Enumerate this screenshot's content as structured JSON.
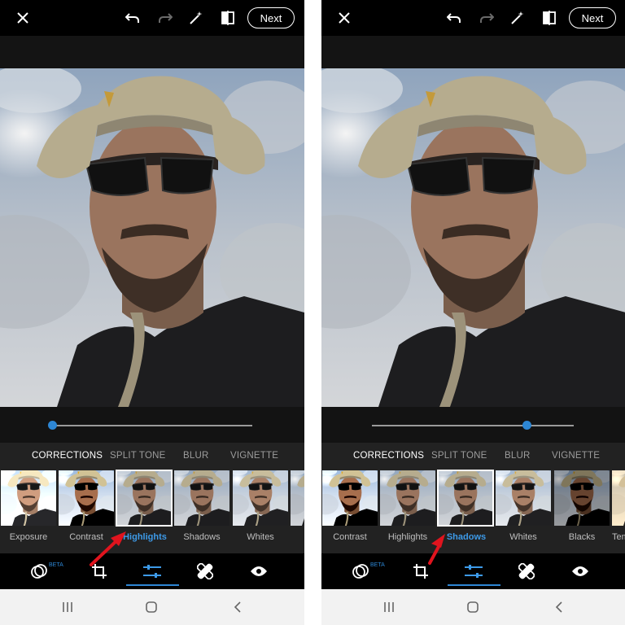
{
  "toolbar": {
    "next_label": "Next"
  },
  "tabs": [
    "CORRECTIONS",
    "SPLIT TONE",
    "BLUR",
    "VIGNETTE"
  ],
  "bottom_tools": {
    "beta_label": "BETA"
  },
  "left_panel": {
    "slider_value_fraction": 0.0,
    "thumbnail_labels": [
      "Exposure",
      "Contrast",
      "Highlights",
      "Shadows",
      "Whites"
    ],
    "selected": "Highlights"
  },
  "right_panel": {
    "slider_value_fraction": 0.77,
    "thumbnail_labels": [
      "Contrast",
      "Highlights",
      "Shadows",
      "Whites",
      "Blacks",
      "Tem"
    ],
    "selected": "Shadows"
  },
  "colors": {
    "accent": "#2d86d4",
    "arrow": "#e0141e"
  }
}
